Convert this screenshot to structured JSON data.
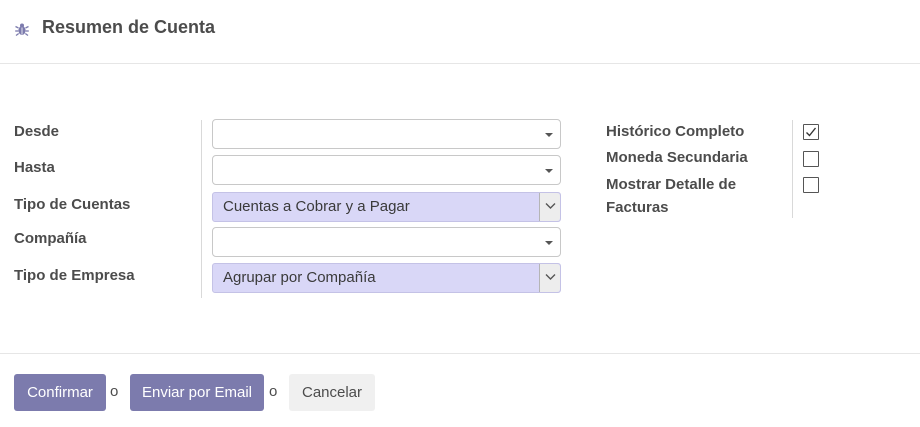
{
  "header": {
    "title": "Resumen de Cuenta",
    "icon": "bug-icon"
  },
  "form": {
    "left": {
      "desde_label": "Desde",
      "desde_value": "",
      "hasta_label": "Hasta",
      "hasta_value": "",
      "tipo_cuentas_label": "Tipo de Cuentas",
      "tipo_cuentas_value": "Cuentas a Cobrar y a Pagar",
      "compania_label": "Compañía",
      "compania_value": "",
      "tipo_empresa_label": "Tipo de Empresa",
      "tipo_empresa_value": "Agrupar por Compañía"
    },
    "right": {
      "historico_label": "Histórico Completo",
      "historico_checked": true,
      "moneda_label": "Moneda Secundaria",
      "moneda_checked": false,
      "detalle_label_line1": "Mostrar Detalle de",
      "detalle_label_line2": "Facturas",
      "detalle_checked": false
    }
  },
  "footer": {
    "confirm_label": "Confirmar",
    "or_1": "o",
    "email_label": "Enviar por Email",
    "or_2": "o",
    "cancel_label": "Cancelar"
  },
  "colors": {
    "primary": "#7c7bad",
    "selection_bg": "#d9d7f7"
  }
}
